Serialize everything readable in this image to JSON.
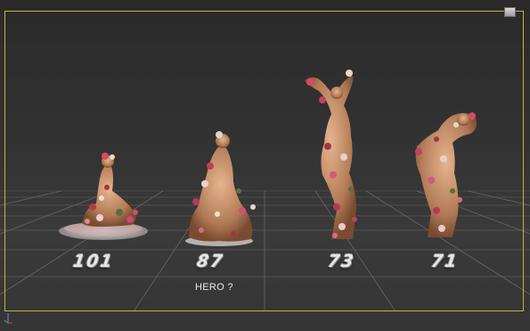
{
  "viewport": {
    "frame_color": "#c9b23a",
    "background": "#333333",
    "grid_color": "#6e6e6e"
  },
  "figures": [
    {
      "id": "figure-101",
      "label": "101",
      "pose": "kneeling-seated"
    },
    {
      "id": "figure-87",
      "label": "87",
      "pose": "kneeling-upright"
    },
    {
      "id": "figure-73",
      "label": "73",
      "pose": "standing-arms-raised"
    },
    {
      "id": "figure-71",
      "label": "71",
      "pose": "standing-bent"
    }
  ],
  "annotation": {
    "text": "HERO ?"
  },
  "icons": {
    "viewcube": "viewcube-icon",
    "axis": "axis-tripod-icon"
  }
}
